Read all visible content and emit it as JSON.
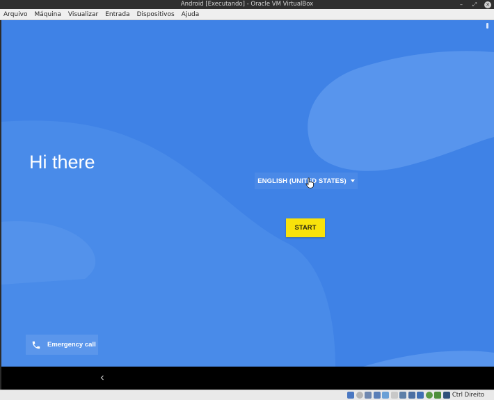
{
  "window": {
    "title": "Android [Executando] - Oracle VM VirtualBox",
    "controls": {
      "minimize": "–",
      "maximize": "⤢"
    }
  },
  "menubar": {
    "items": [
      "Arquivo",
      "Máquina",
      "Visualizar",
      "Entrada",
      "Dispositivos",
      "Ajuda"
    ]
  },
  "android": {
    "greeting": "Hi there",
    "language_select": {
      "value": "ENGLISH (UNITED STATES)"
    },
    "start_button": "START",
    "emergency_call": "Emergency call"
  },
  "statusbar": {
    "host_key_label": "Ctrl Direito",
    "icons": [
      "hard-disk-icon",
      "optical-drive-icon",
      "audio-icon",
      "network-icon",
      "usb-icon",
      "shared-folders-icon",
      "display-icon",
      "video-capture-icon",
      "cpu-icon",
      "mouse-integration-icon",
      "keyboard-icon",
      "host-key-arrow-icon"
    ]
  },
  "colors": {
    "android_background": "#4283e6",
    "start_button": "#f9e20b",
    "nav_bar": "#000000"
  }
}
